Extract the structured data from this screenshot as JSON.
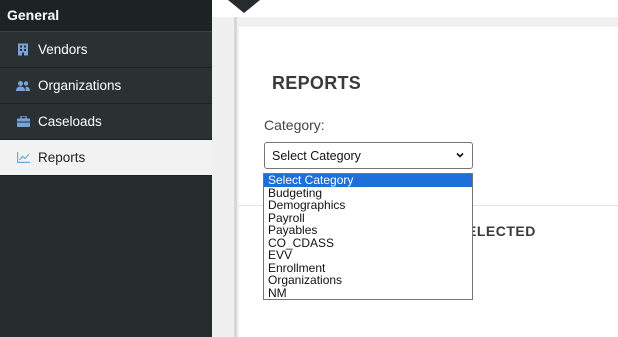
{
  "sidebar": {
    "header": "General",
    "items": [
      {
        "label": "Vendors",
        "icon": "building-icon"
      },
      {
        "label": "Organizations",
        "icon": "users-icon"
      },
      {
        "label": "Caseloads",
        "icon": "briefcase-icon"
      },
      {
        "label": "Reports",
        "icon": "chart-icon",
        "active": true
      }
    ]
  },
  "main": {
    "title": "REPORTS",
    "category_label": "Category:",
    "select": {
      "value": "Select Category",
      "options": [
        "Select Category",
        "Budgeting",
        "Demographics",
        "Payroll",
        "Payables",
        "CO_CDASS",
        "EVV",
        "Enrollment",
        "Organizations",
        "NM"
      ],
      "highlighted": "Select Category"
    },
    "partial_status": "ELECTED"
  },
  "colors": {
    "sidebar_bg": "#262b2d",
    "icon_blue": "#7aa4d8",
    "option_highlight": "#1e6fd9"
  }
}
